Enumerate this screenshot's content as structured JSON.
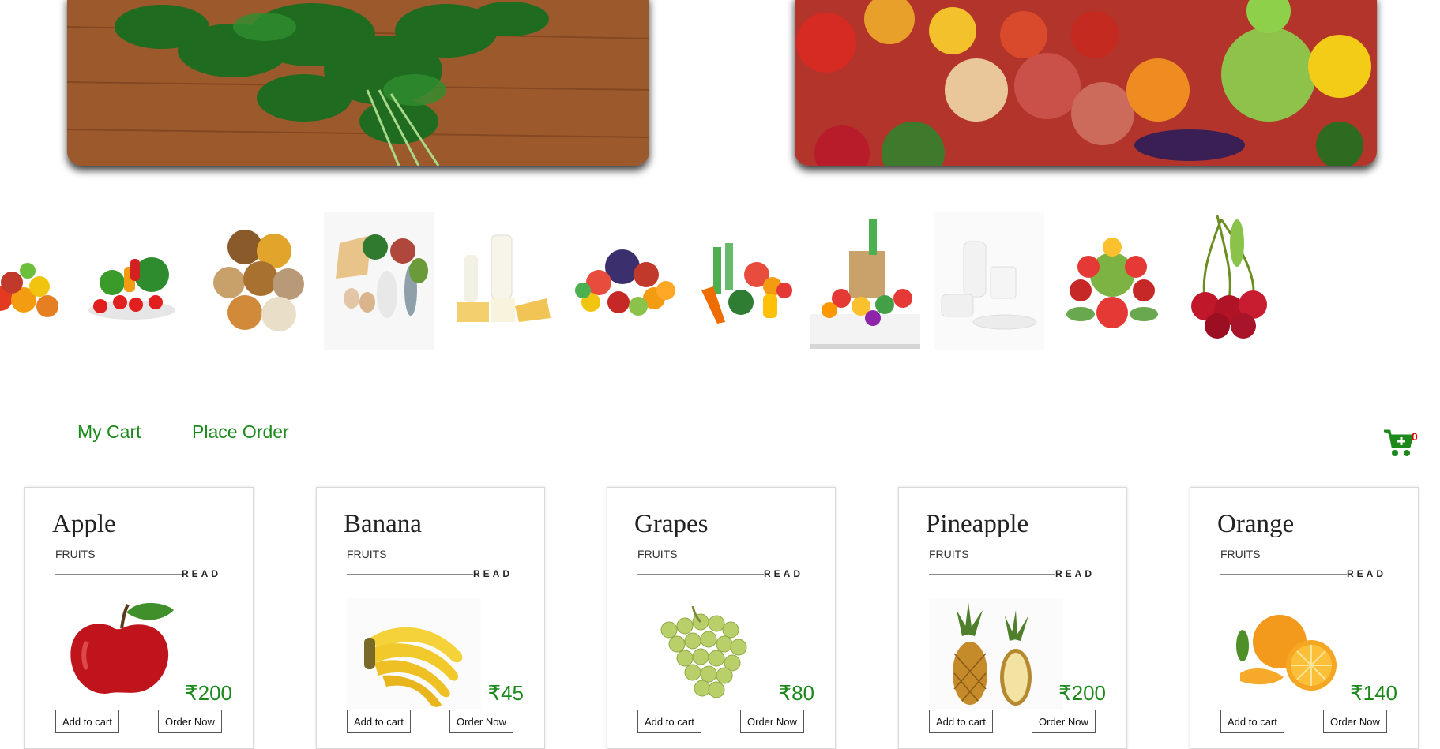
{
  "banners": [
    {
      "name": "banner-spinach",
      "alt_icon": "spinach-on-board-image"
    },
    {
      "name": "banner-vegetables",
      "alt_icon": "vegetable-assortment-image"
    }
  ],
  "categories": [
    {
      "icon": "fruit-pile-partial-icon"
    },
    {
      "icon": "vegetable-bowl-icon"
    },
    {
      "icon": "grains-pulses-icon"
    },
    {
      "icon": "protein-foods-icon"
    },
    {
      "icon": "dairy-products-icon"
    },
    {
      "icon": "fruits-assortment-icon"
    },
    {
      "icon": "vegetables-assortment-icon"
    },
    {
      "icon": "grocery-bag-icon"
    },
    {
      "icon": "milk-products-icon"
    },
    {
      "icon": "salad-vegetables-icon"
    },
    {
      "icon": "cherries-icon"
    }
  ],
  "nav": {
    "my_cart": "My Cart",
    "place_order": "Place Order"
  },
  "cart": {
    "count": "0",
    "icon": "cart-add-icon"
  },
  "colors": {
    "accent_green": "#1b8a1b",
    "badge_red": "#e00000"
  },
  "products": [
    {
      "name": "Apple",
      "category": "FRUITS",
      "read": "READ",
      "price": "₹200",
      "add_label": "Add to cart",
      "order_label": "Order Now",
      "icon": "apple-icon"
    },
    {
      "name": "Banana",
      "category": "FRUITS",
      "read": "READ",
      "price": "₹45",
      "add_label": "Add to cart",
      "order_label": "Order Now",
      "icon": "banana-icon"
    },
    {
      "name": "Grapes",
      "category": "FRUITS",
      "read": "READ",
      "price": "₹80",
      "add_label": "Add to cart",
      "order_label": "Order Now",
      "icon": "grapes-icon"
    },
    {
      "name": "Pineapple",
      "category": "FRUITS",
      "read": "READ",
      "price": "₹200",
      "add_label": "Add to cart",
      "order_label": "Order Now",
      "icon": "pineapple-icon"
    },
    {
      "name": "Orange",
      "category": "FRUITS",
      "read": "READ",
      "price": "₹140",
      "add_label": "Add to cart",
      "order_label": "Order Now",
      "icon": "orange-icon"
    }
  ]
}
